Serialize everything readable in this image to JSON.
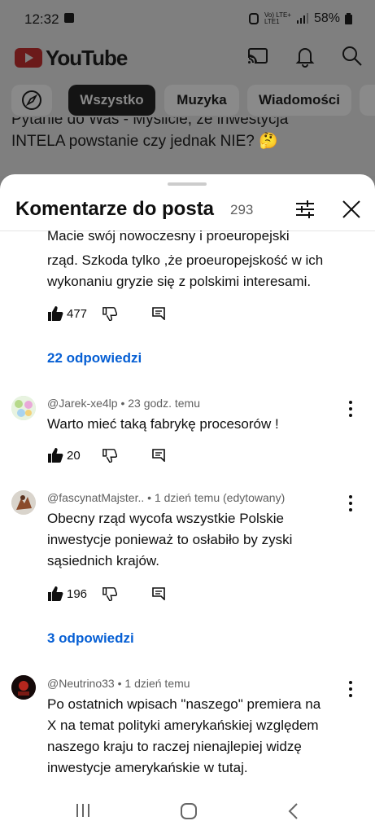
{
  "status_bar": {
    "time": "12:32",
    "network": "Vo) LTE+\nLTE1",
    "battery": "58%"
  },
  "header": {
    "logo_text": "YouTube",
    "icons": [
      "cast-icon",
      "bell-icon",
      "search-icon"
    ]
  },
  "chips": [
    "Wszystko",
    "Muzyka",
    "Wiadomości"
  ],
  "post": {
    "line1": "Pytanie do Was - Myślicie, że inwestycja",
    "line2": "INTELA powstanie czy jednak NIE? 🤔"
  },
  "sheet": {
    "title": "Komentarze do posta",
    "count": "293"
  },
  "comments": [
    {
      "text_lines": [
        "Macie  swój nowoczesny i proeuropejski",
        "rząd. Szkoda tylko ,że proeuropejskość w ich",
        "wykonaniu gryzie się z polskimi interesami."
      ],
      "likes": "477",
      "replies": "22 odpowiedzi"
    },
    {
      "author": "@Jarek-xe4lp",
      "time": "23 godz. temu",
      "text_lines": [
        "Warto mieć taką fabrykę procesorów !"
      ],
      "likes": "20"
    },
    {
      "author": "@fascynatMajster..",
      "time": "1 dzień temu (edytowany)",
      "text_lines": [
        "Obecny rząd wycofa wszystkie Polskie",
        "inwestycje ponieważ to osłabiło by zyski",
        "sąsiednich krajów."
      ],
      "likes": "196",
      "replies": "3 odpowiedzi"
    },
    {
      "author": "@Neutrino33",
      "time": "1 dzień temu",
      "text_lines": [
        "Po ostatnich wpisach \"naszego\" premiera na",
        "X na temat polityki amerykańskiej względem",
        "naszego kraju to raczej nienajlepiej widzę",
        "inwestycje amerykańskie w tutaj."
      ]
    }
  ],
  "separator": "•",
  "colors": {
    "link": "#065fd4",
    "meta": "#606060",
    "overlay": "#7f7f7f"
  }
}
